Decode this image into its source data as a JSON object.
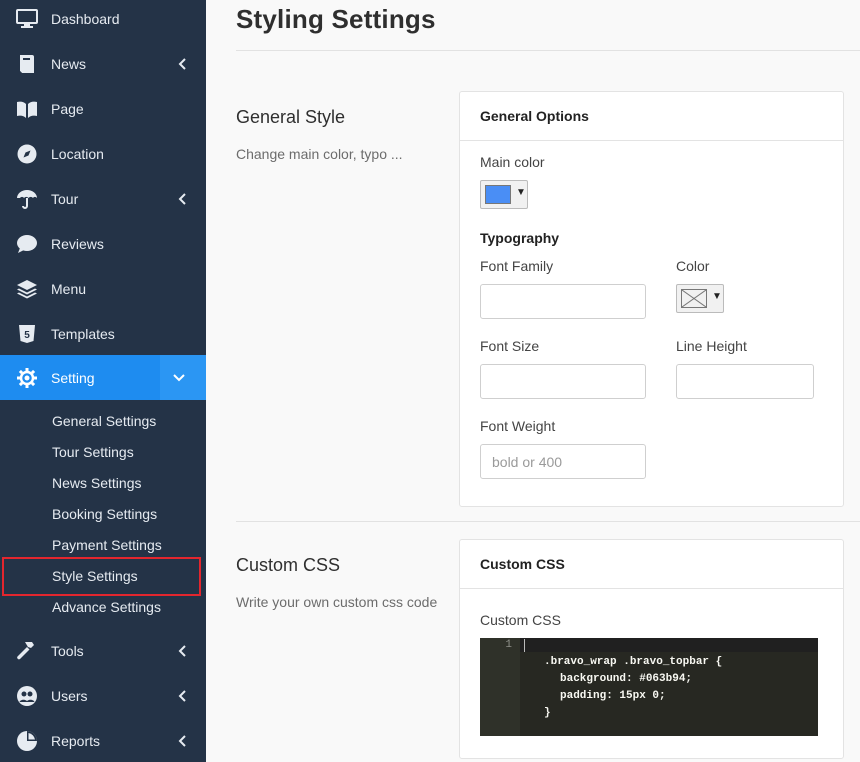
{
  "sidebar": {
    "items": [
      {
        "label": "Dashboard",
        "icon": "monitor-icon"
      },
      {
        "label": "News",
        "icon": "book-icon"
      },
      {
        "label": "Page",
        "icon": "book-open-icon"
      },
      {
        "label": "Location",
        "icon": "compass-icon"
      },
      {
        "label": "Tour",
        "icon": "umbrella-icon"
      },
      {
        "label": "Reviews",
        "icon": "comment-icon"
      },
      {
        "label": "Menu",
        "icon": "layers-icon"
      },
      {
        "label": "Templates",
        "icon": "html5-icon"
      },
      {
        "label": "Setting",
        "icon": "gear-icon"
      },
      {
        "label": "Tools",
        "icon": "hammer-icon"
      },
      {
        "label": "Users",
        "icon": "users-icon"
      },
      {
        "label": "Reports",
        "icon": "pie-chart-icon"
      }
    ],
    "setting_sub": [
      "General Settings",
      "Tour Settings",
      "News Settings",
      "Booking Settings",
      "Payment Settings",
      "Style Settings",
      "Advance Settings"
    ],
    "active_color": "#1e8cf0",
    "bg_color": "#243347"
  },
  "main": {
    "page_title": "Styling Settings",
    "general": {
      "title": "General Style",
      "desc": "Change main color, typo ...",
      "panel_title": "General Options",
      "main_color_label": "Main color",
      "main_color_value": "#4a8ef5",
      "typography_label": "Typography",
      "font_family_label": "Font Family",
      "color_label": "Color",
      "font_size_label": "Font Size",
      "line_height_label": "Line Height",
      "font_weight_label": "Font Weight",
      "font_weight_placeholder": "bold or 400"
    },
    "custom_css": {
      "title": "Custom CSS",
      "desc": "Write your own custom css code",
      "panel_title": "Custom CSS",
      "field_label": "Custom CSS",
      "line_number": "1",
      "code_lines": [
        ".bravo_wrap .bravo_topbar {",
        "background: #063b94;",
        "padding: 15px 0;",
        "}"
      ]
    }
  }
}
